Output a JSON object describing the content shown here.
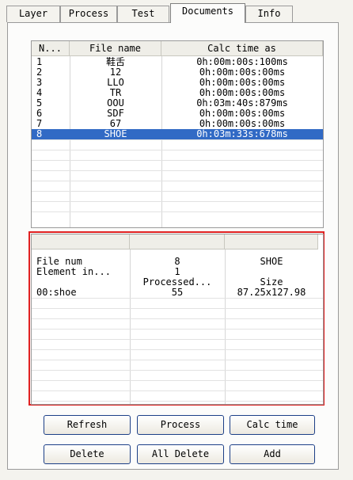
{
  "tabs": [
    "Layer",
    "Process",
    "Test",
    "Documents",
    "Info"
  ],
  "documents_table": {
    "headers": [
      "N...",
      "File name",
      "Calc time as"
    ],
    "rows": [
      [
        "1",
        "鞋舌",
        "0h:00m:00s:100ms"
      ],
      [
        "2",
        "12",
        "0h:00m:00s:00ms"
      ],
      [
        "3",
        "LLO",
        "0h:00m:00s:00ms"
      ],
      [
        "4",
        "TR",
        "0h:00m:00s:00ms"
      ],
      [
        "5",
        "OOU",
        "0h:03m:40s:879ms"
      ],
      [
        "6",
        "SDF",
        "0h:00m:00s:00ms"
      ],
      [
        "7",
        "67",
        "0h:00m:00s:00ms"
      ],
      [
        "8",
        "SHOE",
        "0h:03m:33s:678ms"
      ]
    ],
    "selected_index": 7
  },
  "detail_table": {
    "rows": [
      [
        "File num",
        "8",
        "SHOE"
      ],
      [
        "Element in...",
        "1",
        ""
      ],
      [
        "",
        "Processed...",
        "Size"
      ],
      [
        "00:shoe",
        "55",
        "87.25x127.98"
      ]
    ]
  },
  "buttons": {
    "refresh": "Refresh",
    "process": "Process",
    "calc_time": "Calc time",
    "delete": "Delete",
    "all_delete": "All Delete",
    "add": "Add"
  },
  "colors": {
    "selection": "#316ac5",
    "highlight_box": "#e02020"
  }
}
